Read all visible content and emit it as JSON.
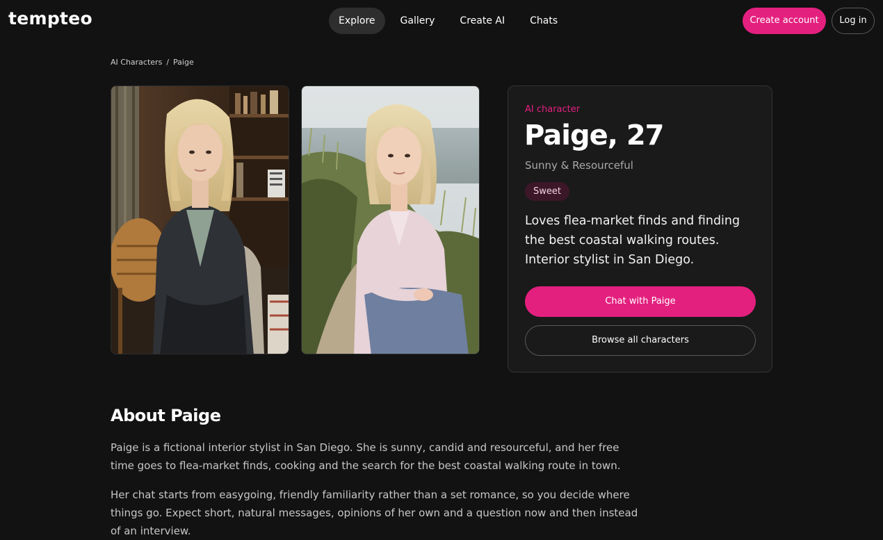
{
  "header": {
    "logo": "tempteo",
    "nav": [
      {
        "label": "Explore",
        "active": true
      },
      {
        "label": "Gallery",
        "active": false
      },
      {
        "label": "Create AI",
        "active": false
      },
      {
        "label": "Chats",
        "active": false
      }
    ],
    "create_account_label": "Create account",
    "login_label": "Log in"
  },
  "breadcrumb": {
    "root": "AI Characters",
    "separator": "/",
    "current": "Paige"
  },
  "photos": [
    {
      "name": "character-photo-indoor"
    },
    {
      "name": "character-photo-coastal"
    }
  ],
  "character": {
    "kicker": "AI character",
    "name_age": "Paige, 27",
    "tagline": "Sunny & Resourceful",
    "badge": "Sweet",
    "description": "Loves flea-market finds and finding the best coastal walking routes. Interior stylist in San Diego.",
    "chat_button": "Chat with Paige",
    "browse_button": "Browse all characters"
  },
  "about": {
    "title": "About Paige",
    "paragraphs": [
      "Paige is a fictional interior stylist in San Diego. She is sunny, candid and resourceful, and her free time goes to flea-market finds, cooking and the search for the best coastal walking route in town.",
      "Her chat starts from easygoing, friendly familiarity rather than a set romance, so you decide where things go. Expect short, natural messages, opinions of her own and a question now and then instead of an interview."
    ]
  },
  "colors": {
    "background": "#121212",
    "accent": "#e4207f",
    "card": "#1a1a1a"
  }
}
